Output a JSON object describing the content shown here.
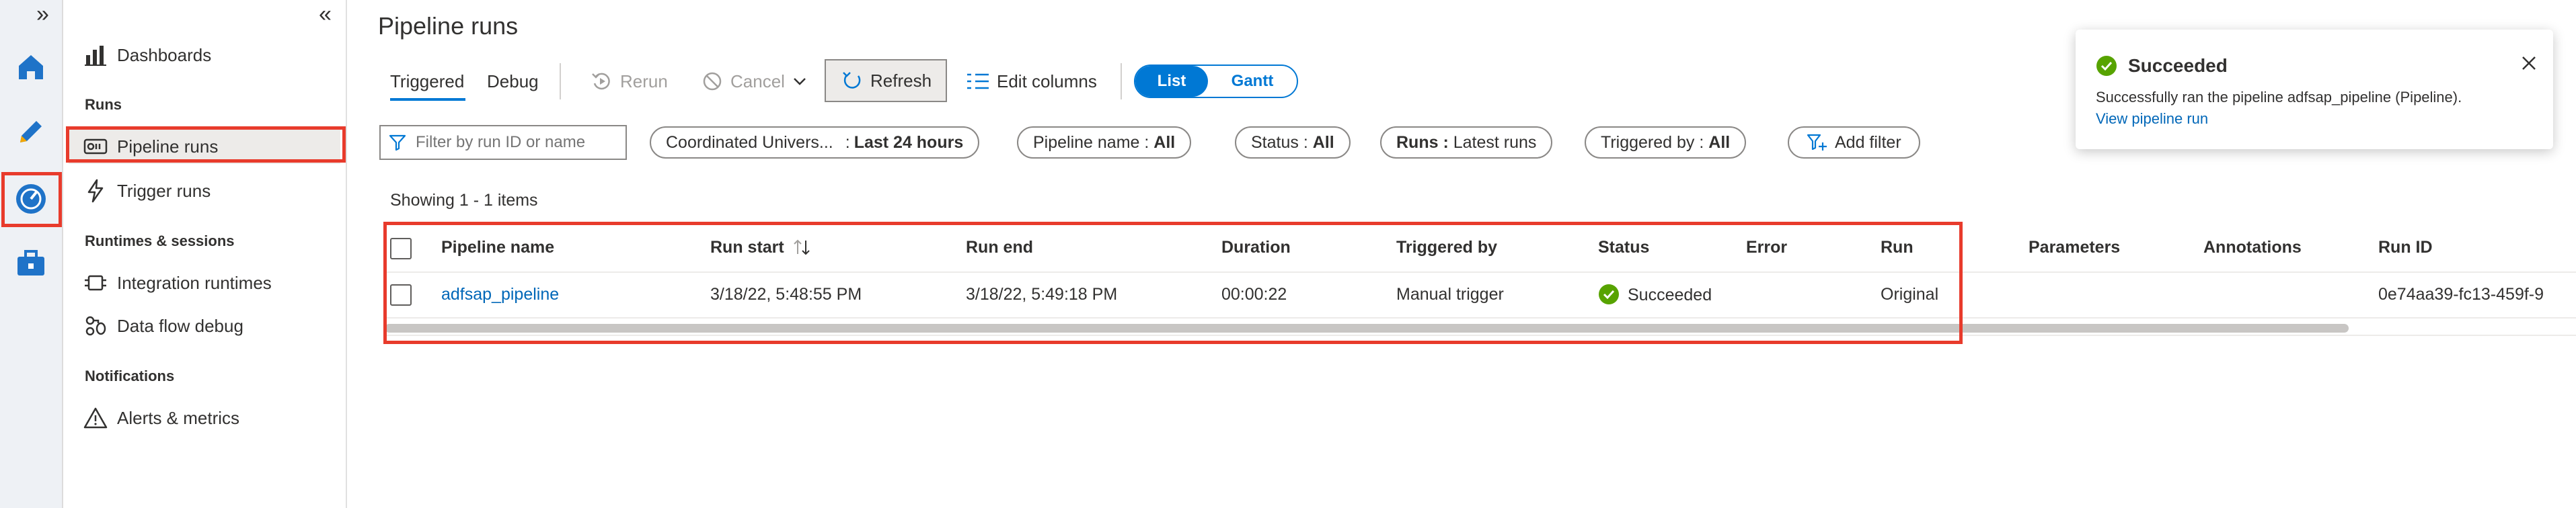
{
  "rail": {
    "expand_glyph": "»",
    "items": [
      "home-icon",
      "author-pencil-icon",
      "monitor-gauge-icon",
      "manage-toolbox-icon"
    ]
  },
  "nav": {
    "collapse_glyph": "«",
    "dashboards": "Dashboards",
    "section_runs": "Runs",
    "pipeline_runs": "Pipeline runs",
    "trigger_runs": "Trigger runs",
    "section_runtimes": "Runtimes & sessions",
    "integration_runtimes": "Integration runtimes",
    "data_flow_debug": "Data flow debug",
    "section_notifications": "Notifications",
    "alerts_metrics": "Alerts & metrics"
  },
  "page": {
    "title": "Pipeline runs",
    "tabs": {
      "triggered": "Triggered",
      "debug": "Debug"
    },
    "toolbar": {
      "rerun": "Rerun",
      "cancel": "Cancel",
      "refresh": "Refresh",
      "edit_columns": "Edit columns",
      "view_list": "List",
      "view_gantt": "Gantt"
    },
    "filters": {
      "search_placeholder": "Filter by run ID or name",
      "timezone_label": "Coordinated Univers...",
      "timezone_value": "Last 24 hours",
      "pipeline_name_label": "Pipeline name : ",
      "pipeline_name_value": "All",
      "status_label": "Status : ",
      "status_value": "All",
      "runs_label": "Runs : ",
      "runs_value": "Latest runs",
      "triggered_by_label": "Triggered by : ",
      "triggered_by_value": "All",
      "add_filter": "Add filter"
    },
    "showing": "Showing 1 - 1 items"
  },
  "table": {
    "columns": {
      "pipeline_name": "Pipeline name",
      "run_start": "Run start",
      "run_end": "Run end",
      "duration": "Duration",
      "triggered_by": "Triggered by",
      "status": "Status",
      "error": "Error",
      "run": "Run",
      "parameters": "Parameters",
      "annotations": "Annotations",
      "run_id": "Run ID"
    },
    "rows": [
      {
        "pipeline_name": "adfsap_pipeline",
        "run_start": "3/18/22, 5:48:55 PM",
        "run_end": "3/18/22, 5:49:18 PM",
        "duration": "00:00:22",
        "triggered_by": "Manual trigger",
        "status": "Succeeded",
        "error": "",
        "run": "Original",
        "parameters": "",
        "annotations": "",
        "run_id": "0e74aa39-fc13-459f-9"
      }
    ]
  },
  "toast": {
    "title": "Succeeded",
    "message": "Successfully ran the pipeline adfsap_pipeline (Pipeline).",
    "link": "View pipeline run"
  },
  "colors": {
    "accent": "#0078d4",
    "success": "#57a300",
    "highlight_box": "#e83b2c",
    "link": "#0067b8"
  }
}
